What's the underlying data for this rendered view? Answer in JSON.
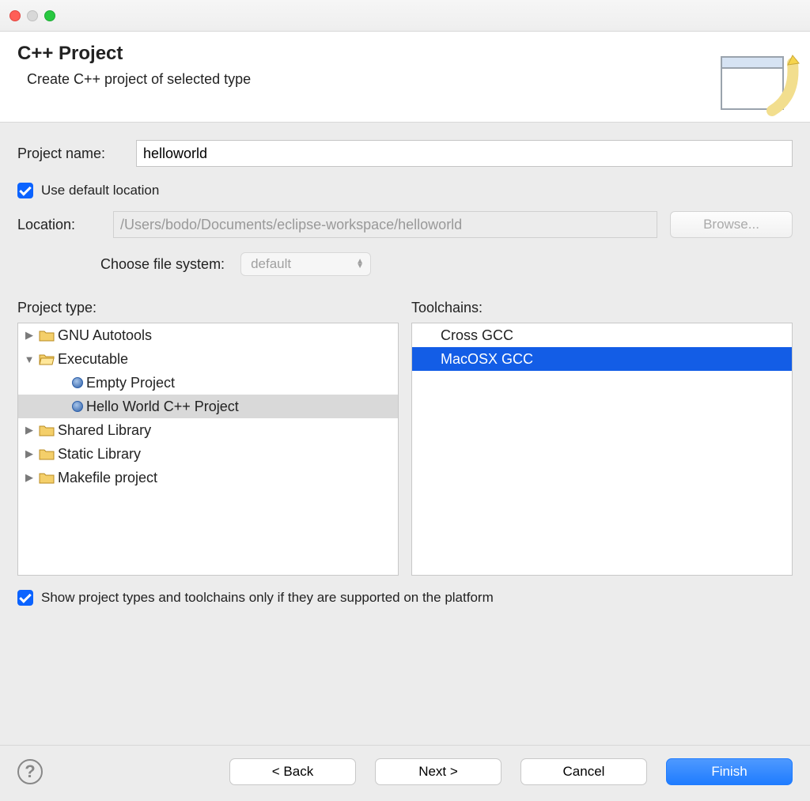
{
  "header": {
    "title": "C++ Project",
    "subtitle": "Create C++ project of selected type"
  },
  "project_name_label": "Project name:",
  "project_name_value": "helloworld",
  "use_default_location_label": "Use default location",
  "use_default_location_checked": true,
  "location_label": "Location:",
  "location_value": "/Users/bodo/Documents/eclipse-workspace/helloworld",
  "browse_label": "Browse...",
  "choose_fs_label": "Choose file system:",
  "choose_fs_value": "default",
  "project_type_label": "Project type:",
  "toolchains_label": "Toolchains:",
  "tree": {
    "gnu_autotools": "GNU Autotools",
    "executable": "Executable",
    "empty_project": "Empty Project",
    "hello_world": "Hello World C++ Project",
    "shared_library": "Shared Library",
    "static_library": "Static Library",
    "makefile_project": "Makefile project"
  },
  "toolchains": {
    "cross_gcc": "Cross GCC",
    "macosx_gcc": "MacOSX GCC"
  },
  "filter_label": "Show project types and toolchains only if they are supported on the platform",
  "filter_checked": true,
  "buttons": {
    "back": "< Back",
    "next": "Next >",
    "cancel": "Cancel",
    "finish": "Finish"
  }
}
